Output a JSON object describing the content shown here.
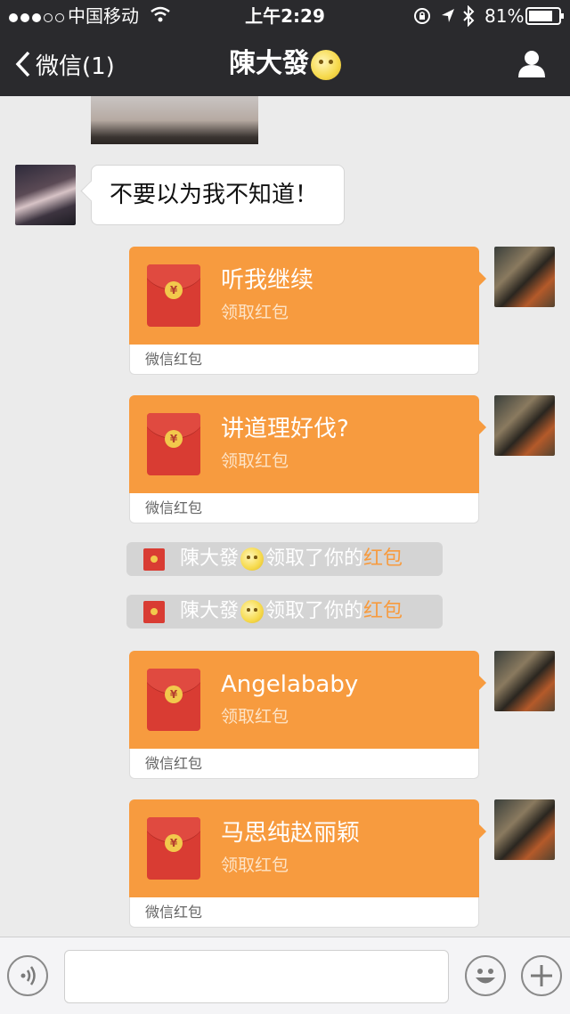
{
  "status_bar": {
    "carrier": "中国移动",
    "time": "上午2:29",
    "battery": "81%"
  },
  "nav": {
    "back_label": "微信(1)",
    "title": "陳大發"
  },
  "messages": {
    "text_1": "不要以为我不知道！",
    "red_packets": [
      {
        "title": "听我继续",
        "subtitle": "领取红包",
        "label": "微信红包"
      },
      {
        "title": "讲道理好伐?",
        "subtitle": "领取红包",
        "label": "微信红包"
      },
      {
        "title": "Angelababy",
        "subtitle": "领取红包",
        "label": "微信红包"
      },
      {
        "title": "马思纯赵丽颖",
        "subtitle": "领取红包",
        "label": "微信红包"
      }
    ],
    "system": [
      {
        "name": "陳大發",
        "text": "领取了你的",
        "highlight": "红包"
      },
      {
        "name": "陳大發",
        "text": "领取了你的",
        "highlight": "红包"
      }
    ]
  },
  "coin_symbol": "¥",
  "colors": {
    "header_bg": "#2a2a2d",
    "chat_bg": "#ebebeb",
    "red_packet": "#f79b3f",
    "envelope": "#d93c33"
  }
}
